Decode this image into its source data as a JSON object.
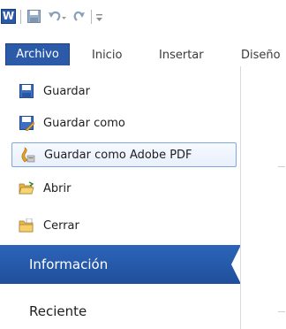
{
  "qat": {
    "logo_letter": "W",
    "items": [
      {
        "name": "word-logo-icon"
      },
      {
        "name": "save-icon"
      },
      {
        "name": "undo-icon"
      },
      {
        "name": "redo-icon"
      },
      {
        "name": "customize-qat-icon"
      }
    ]
  },
  "tabs": {
    "file": "Archivo",
    "home": "Inicio",
    "insert": "Insertar",
    "design": "Diseño"
  },
  "commands": [
    {
      "label": "Guardar",
      "icon": "save-icon"
    },
    {
      "label": "Guardar como",
      "icon": "save-as-icon"
    },
    {
      "label": "Guardar como Adobe PDF",
      "icon": "adobe-pdf-icon"
    },
    {
      "label": "Abrir",
      "icon": "open-folder-icon"
    },
    {
      "label": "Cerrar",
      "icon": "close-folder-icon"
    }
  ],
  "nav": {
    "info": "Información",
    "recent": "Reciente"
  },
  "colors": {
    "file_tab": "#2a5aa8",
    "selected_nav": "#2d64b8",
    "selected_border": "#7ea8e0"
  }
}
